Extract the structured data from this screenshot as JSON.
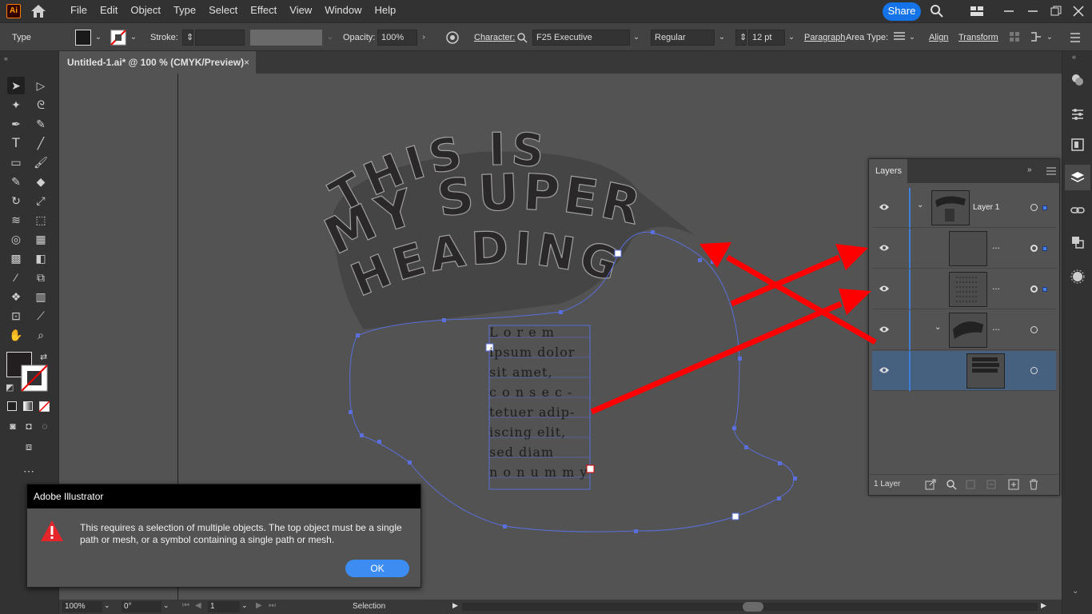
{
  "app": {
    "logo": "Ai",
    "menus": [
      "File",
      "Edit",
      "Object",
      "Type",
      "Select",
      "Effect",
      "View",
      "Window",
      "Help"
    ],
    "share_label": "Share"
  },
  "control": {
    "mode_label": "Type",
    "stroke_label": "Stroke:",
    "opacity_label": "Opacity:",
    "opacity_value": "100%",
    "character_label": "Character:",
    "font_value": "F25 Executive",
    "style_value": "Regular",
    "size_value": "12 pt",
    "paragraph_label": "Paragraph",
    "areatype_label": "Area Type:",
    "align_label": "Align",
    "transform_label": "Transform"
  },
  "document": {
    "tab_title": "Untitled-1.ai* @ 100 % (CMYK/Preview)",
    "close": "×"
  },
  "artwork": {
    "heading_lines": [
      "THIS IS",
      "MY SUPER",
      "HEADING"
    ],
    "body_lines": [
      "L o r e m",
      "ipsum dolor",
      "sit amet,",
      "c o n s e c -",
      "tetuer adip-",
      "iscing elit,",
      "sed diam",
      "n o n u m m y"
    ],
    "arrow_color": "#ff0000",
    "path_color": "#5a6fdc"
  },
  "layers_panel": {
    "tab_label": "Layers",
    "layer_name": "Layer 1",
    "sublayer_dots": "...",
    "count_label": "1 Layer"
  },
  "dialog": {
    "title": "Adobe Illustrator",
    "message": "This requires a selection of multiple objects. The top object must be a single path or mesh, or a symbol containing a single path or mesh.",
    "ok_label": "OK"
  },
  "status": {
    "zoom": "100%",
    "rotation": "0°",
    "artboard": "1",
    "mode": "Selection"
  }
}
